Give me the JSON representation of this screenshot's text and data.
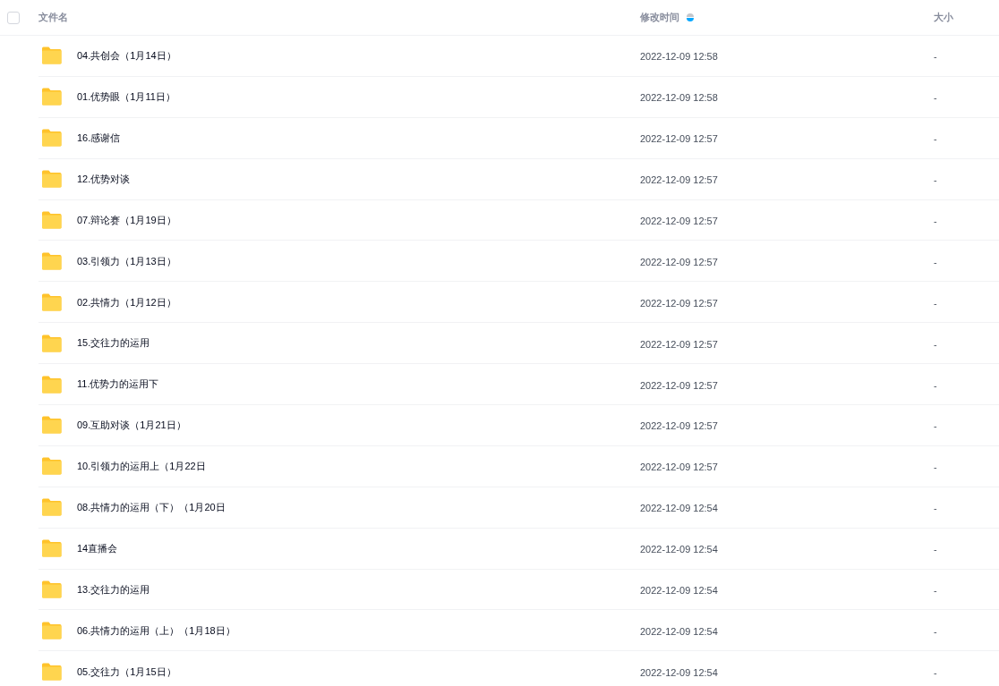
{
  "table": {
    "select_all": {
      "checked": false
    },
    "columns": [
      {
        "label": "文件名"
      },
      {
        "label": "修改时间",
        "sorted_descending": true
      },
      {
        "label": "大小"
      }
    ],
    "rows": [
      {
        "name": "04.共创会（1月14日）",
        "modified": "2022-12-09 12:58",
        "size": "-"
      },
      {
        "name": "01.优势眼（1月11日）",
        "modified": "2022-12-09 12:58",
        "size": "-"
      },
      {
        "name": "16.感谢信",
        "modified": "2022-12-09 12:57",
        "size": "-"
      },
      {
        "name": "12.优势对谈",
        "modified": "2022-12-09 12:57",
        "size": "-"
      },
      {
        "name": "07.辩论赛（1月19日）",
        "modified": "2022-12-09 12:57",
        "size": "-"
      },
      {
        "name": "03.引领力（1月13日）",
        "modified": "2022-12-09 12:57",
        "size": "-"
      },
      {
        "name": "02.共情力（1月12日）",
        "modified": "2022-12-09 12:57",
        "size": "-"
      },
      {
        "name": "15.交往力的运用",
        "modified": "2022-12-09 12:57",
        "size": "-"
      },
      {
        "name": "11.优势力的运用下",
        "modified": "2022-12-09 12:57",
        "size": "-"
      },
      {
        "name": "09.互助对谈（1月21日）",
        "modified": "2022-12-09 12:57",
        "size": "-"
      },
      {
        "name": "10.引领力的运用上（1月22日",
        "modified": "2022-12-09 12:57",
        "size": "-"
      },
      {
        "name": "08.共情力的运用（下）（1月20日",
        "modified": "2022-12-09 12:54",
        "size": "-"
      },
      {
        "name": "14直播会",
        "modified": "2022-12-09 12:54",
        "size": "-"
      },
      {
        "name": "13.交往力的运用",
        "modified": "2022-12-09 12:54",
        "size": "-"
      },
      {
        "name": "06.共情力的运用（上）（1月18日）",
        "modified": "2022-12-09 12:54",
        "size": "-"
      },
      {
        "name": "05.交往力（1月15日）",
        "modified": "2022-12-09 12:54",
        "size": "-"
      }
    ]
  }
}
